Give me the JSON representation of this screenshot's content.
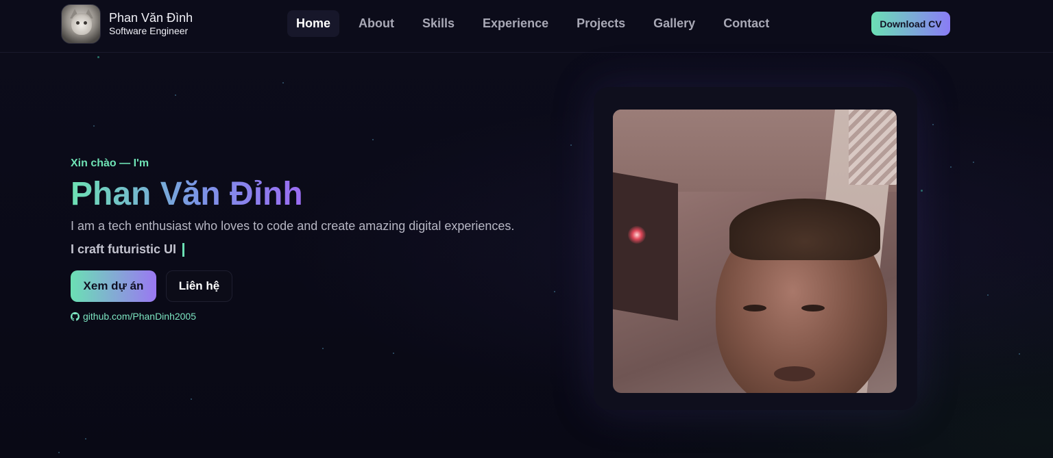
{
  "brand": {
    "name": "Phan Văn Đình",
    "role": "Software Engineer"
  },
  "nav": {
    "items": [
      {
        "label": "Home",
        "active": true
      },
      {
        "label": "About",
        "active": false
      },
      {
        "label": "Skills",
        "active": false
      },
      {
        "label": "Experience",
        "active": false
      },
      {
        "label": "Projects",
        "active": false
      },
      {
        "label": "Gallery",
        "active": false
      },
      {
        "label": "Contact",
        "active": false
      }
    ]
  },
  "header": {
    "download_cv_label": "Download CV"
  },
  "hero": {
    "greeting": "Xin chào — I'm",
    "name": "Phan Văn Đỉnh",
    "description": "I am a tech enthusiast who loves to code and create amazing digital experiences.",
    "typed_text": "I craft futuristic UI",
    "primary_button": "Xem dự án",
    "secondary_button": "Liên hệ",
    "github_link": "github.com/PhanDinh2005"
  },
  "colors": {
    "accent_green": "#6be0b4",
    "accent_purple": "#9a78f2",
    "background": "#0a0a17"
  },
  "icons": {
    "github": "github-icon"
  }
}
